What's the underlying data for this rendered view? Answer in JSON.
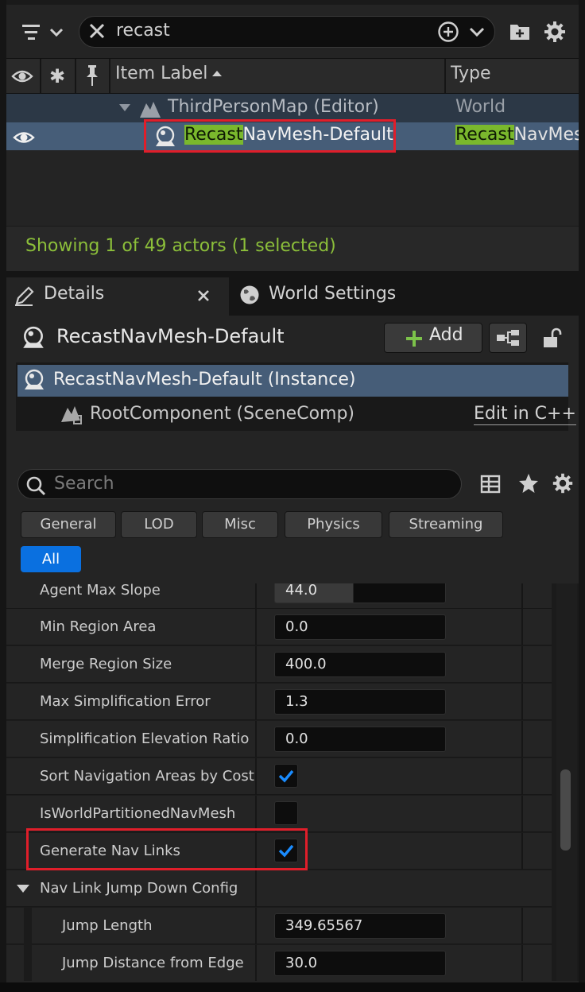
{
  "outliner": {
    "search_value": "recast",
    "columns": {
      "label": "Item Label",
      "type": "Type"
    },
    "rows": [
      {
        "label": "ThirdPersonMap (Editor)",
        "type": "World"
      },
      {
        "label_match": "Recast",
        "label_rest": "NavMesh-Default",
        "type_match": "Recast",
        "type_rest": "NavMes"
      }
    ],
    "status": "Showing 1 of 49 actors (1 selected)"
  },
  "tabs": {
    "details": "Details",
    "world_settings": "World Settings"
  },
  "details": {
    "actor_name": "RecastNavMesh-Default",
    "add_label": "Add",
    "components": {
      "instance": "RecastNavMesh-Default (Instance)",
      "root": "RootComponent (SceneComp)",
      "edit_link": "Edit in C++"
    },
    "search_placeholder": "Search",
    "categories": [
      "General",
      "LOD",
      "Misc",
      "Physics",
      "Streaming"
    ],
    "category_all": "All",
    "properties": [
      {
        "name": "Agent Max Slope",
        "value": "44.0"
      },
      {
        "name": "Min Region Area",
        "value": "0.0"
      },
      {
        "name": "Merge Region Size",
        "value": "400.0"
      },
      {
        "name": "Max Simplification Error",
        "value": "1.3"
      },
      {
        "name": "Simplification Elevation Ratio",
        "value": "0.0"
      },
      {
        "name": "Sort Navigation Areas by Cost",
        "checked": true
      },
      {
        "name": "IsWorldPartitionedNavMesh",
        "checked": false
      },
      {
        "name": "Generate Nav Links",
        "checked": true
      },
      {
        "name": "Nav Link Jump Down Config"
      },
      {
        "name": "Jump Length",
        "value": "349.65567"
      },
      {
        "name": "Jump Distance from Edge",
        "value": "30.0"
      }
    ]
  },
  "colors": {
    "selection": "#465d78",
    "highlight": "#7ab82d",
    "status": "#8cbf3a",
    "accent": "#0a70e0",
    "annotation": "#e01e2a"
  }
}
